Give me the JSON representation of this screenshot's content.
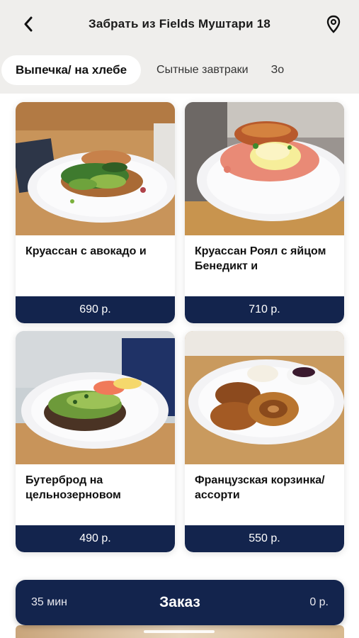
{
  "header": {
    "title": "Забрать из Fields Муштари 18",
    "back_icon": "chevron-left-icon",
    "location_icon": "map-pin-icon"
  },
  "tabs": [
    {
      "label": "Выпечка/ на хлебе",
      "active": true
    },
    {
      "label": "Сытные завтраки",
      "active": false
    },
    {
      "label": "Зо",
      "active": false
    }
  ],
  "products": [
    {
      "name": "Круассан с авокадо и",
      "price": "690 р."
    },
    {
      "name": "Круассан Роял с яйцом Бенедикт и",
      "price": "710 р."
    },
    {
      "name": "Бутерброд на цельнозерновом",
      "price": "490 р."
    },
    {
      "name": "Французская корзинка/ассорти",
      "price": "550 р."
    }
  ],
  "order_bar": {
    "time": "35 мин",
    "label": "Заказ",
    "total": "0 р."
  },
  "colors": {
    "accent": "#13244d",
    "background": "#efeeec",
    "card": "#ffffff"
  }
}
